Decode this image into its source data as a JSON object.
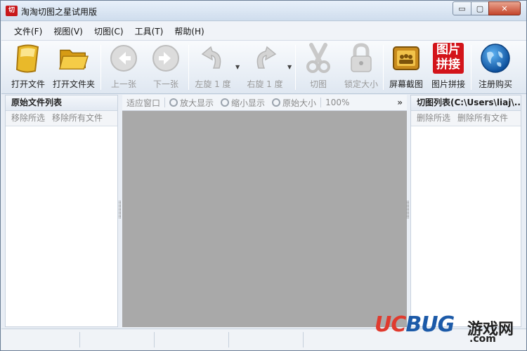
{
  "window": {
    "title": "淘淘切图之星试用版",
    "icon_text": "切",
    "min_glyph": "▭",
    "max_glyph": "▢",
    "close_glyph": "✕"
  },
  "menu": [
    "文件(F)",
    "视图(V)",
    "切图(C)",
    "工具(T)",
    "帮助(H)"
  ],
  "toolbar": {
    "open_file": "打开文件",
    "open_folder": "打开文件夹",
    "prev": "上一张",
    "next": "下一张",
    "rotate_left": "左旋 1 度",
    "rotate_right": "右旋 1 度",
    "cut": "切图",
    "lock_size": "锁定大小",
    "screenshot": "屏幕截图",
    "stitch": "图片拼接",
    "stitch_icon_line1": "图片",
    "stitch_icon_line2": "拼接",
    "register": "注册购买"
  },
  "left_panel": {
    "title": "原始文件列表",
    "remove_selected": "移除所选",
    "remove_all": "移除所有文件"
  },
  "view_toolbar": {
    "fit_window": "适应窗口",
    "zoom_in": "放大显示",
    "zoom_out": "缩小显示",
    "original_size": "原始大小",
    "zoom": "100%",
    "more": "»"
  },
  "right_panel": {
    "title": "切图列表(C:\\Users\\liaj\\...",
    "delete_selected": "删除所选",
    "delete_all": "删除所有文件"
  },
  "watermark": {
    "u": "U",
    "c": "C",
    "bug": "BUG",
    "cn": "游戏网",
    "com": ".com"
  },
  "colors": {
    "accent": "#1c5aa8",
    "canvas": "#a9a9a9",
    "close": "#c4442a"
  }
}
